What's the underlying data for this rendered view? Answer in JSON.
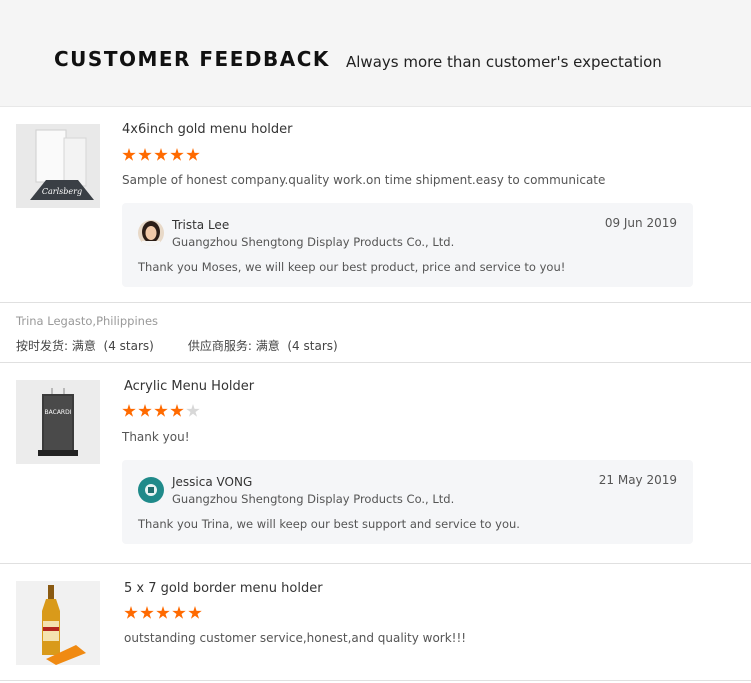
{
  "header": {
    "title": "CUSTOMER FEEDBACK",
    "subtitle": "Always more than customer's expectation"
  },
  "colors": {
    "star_on": "#ff6a00",
    "star_off": "#d8d8d8",
    "header_bg": "#f5f5f5",
    "reply_bg": "#f5f6f8"
  },
  "reviews": [
    {
      "product": "4x6inch gold menu holder",
      "rating": 5,
      "comment": "Sample of honest company.quality work.on time shipment.easy to communicate",
      "thumb_icon": "acrylic-sign-holder-photo",
      "reply": {
        "name": "Trista Lee",
        "company": "Guangzhou Shengtong Display Products Co., Ltd.",
        "date": "09 Jun 2019",
        "text": "Thank you Moses, we will keep our best product, price and service to you!",
        "avatar_icon": "woman-avatar"
      }
    },
    {
      "product": "Acrylic Menu Holder",
      "rating": 4,
      "comment": "Thank you!",
      "thumb_icon": "acrylic-menu-holder-photo",
      "reply": {
        "name": "Jessica VONG",
        "company": "Guangzhou Shengtong Display Products Co., Ltd.",
        "date": "21 May 2019",
        "text": "Thank you Trina, we will keep our best support and service to you.",
        "avatar_icon": "teal-avatar"
      }
    },
    {
      "product": "5 x 7 gold border menu holder",
      "rating": 5,
      "comment": "outstanding customer service,honest,and quality work!!!",
      "thumb_icon": "bottle-with-holder-photo"
    }
  ],
  "reviewer_block": {
    "reviewer": "Trina Legasto,Philippines",
    "delivery_label": "按时发货:",
    "delivery_value": "满意",
    "delivery_stars": "(4 stars)",
    "service_label": "供应商服务:",
    "service_value": "满意",
    "service_stars": "(4 stars)"
  }
}
